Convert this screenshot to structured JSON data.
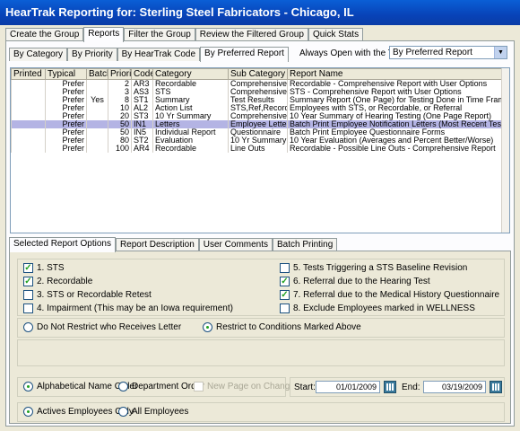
{
  "window": {
    "title": "HearTrak Reporting for: Sterling Steel Fabricators - Chicago, IL"
  },
  "main_tabs": [
    "Create the Group",
    "Reports",
    "Filter the Group",
    "Review the Filtered Group",
    "Quick Stats"
  ],
  "report_tabs": [
    "By Category",
    "By Priority",
    "By HearTrak Code",
    "By Preferred Report"
  ],
  "always_open": {
    "label": "Always Open with the Tab:",
    "value": "By Preferred Report"
  },
  "grid": {
    "columns": [
      "Printed",
      "Typical",
      "Batch",
      "Priority",
      "Code",
      "Category",
      "Sub Category",
      "Report Name"
    ],
    "rows": [
      [
        "",
        "Prefer",
        "",
        "2",
        "AR3",
        "Recordable",
        "Comprehensive",
        "Recordable - Comprehensive Report with User Options"
      ],
      [
        "",
        "Prefer",
        "",
        "3",
        "AS3",
        "STS",
        "Comprehensive",
        "STS - Comprehensive Report with User Options"
      ],
      [
        "",
        "Prefer",
        "Yes",
        "8",
        "ST1",
        "Summary",
        "Test Results",
        "Summary Report (One Page) for Testing Done in Time Frame"
      ],
      [
        "",
        "Prefer",
        "",
        "10",
        "AL2",
        "Action List",
        "STS,Ref,Record",
        "Employees with STS, or Recordable, or Referral"
      ],
      [
        "",
        "Prefer",
        "",
        "20",
        "ST3",
        "10 Yr Summary",
        "Comprehensive",
        "10 Year Summary of Hearing Testing (One Page Report)"
      ],
      [
        "",
        "Prefer",
        "",
        "50",
        "IN1",
        "Letters",
        "Employee Letter",
        "Batch Print Employee Notification Letters (Most Recent Test)"
      ],
      [
        "",
        "Prefer",
        "",
        "50",
        "IN5",
        "Individual Report",
        "Questionnaire",
        "Batch Print Employee Questionnaire Forms"
      ],
      [
        "",
        "Prefer",
        "",
        "80",
        "ST2",
        "Evaluation",
        "10 Yr Summary",
        "10 Year Evaluation (Averages and Percent Better/Worse)"
      ],
      [
        "",
        "Prefer",
        "",
        "100",
        "AR4",
        "Recordable",
        "Line Outs",
        "Recordable - Possible Line Outs - Comprehensive Report"
      ]
    ],
    "selected_row": 5
  },
  "lower_tabs": [
    "Selected Report Options",
    "Report Description",
    "User Comments",
    "Batch Printing"
  ],
  "options": {
    "left": [
      {
        "label": "1. STS",
        "checked": true
      },
      {
        "label": "2. Recordable",
        "checked": true
      },
      {
        "label": "3. STS or Recordable Retest",
        "checked": false
      },
      {
        "label": "4. Impairment (This may be an Iowa requirement)",
        "checked": false
      }
    ],
    "right": [
      {
        "label": "5. Tests Triggering a STS Baseline Revision",
        "checked": false
      },
      {
        "label": "6. Referral due to the Hearing Test",
        "checked": true
      },
      {
        "label": "7. Referral due to the Medical History Questionnaire",
        "checked": true
      },
      {
        "label": "8. Exclude Employees marked in WELLNESS",
        "checked": false
      }
    ]
  },
  "restrict": {
    "no_restrict": "Do Not Restrict who Receives Letter",
    "restrict": "Restrict to Conditions Marked Above"
  },
  "order": {
    "alpha": "Alphabetical Name Order",
    "dept": "Department Order",
    "newpage": "New Page on Change"
  },
  "dates": {
    "start_label": "Start:",
    "start": "01/01/2009",
    "end_label": "End:",
    "end": "03/19/2009"
  },
  "employees": {
    "active": "Actives Employees Only",
    "all": "All Employees"
  }
}
